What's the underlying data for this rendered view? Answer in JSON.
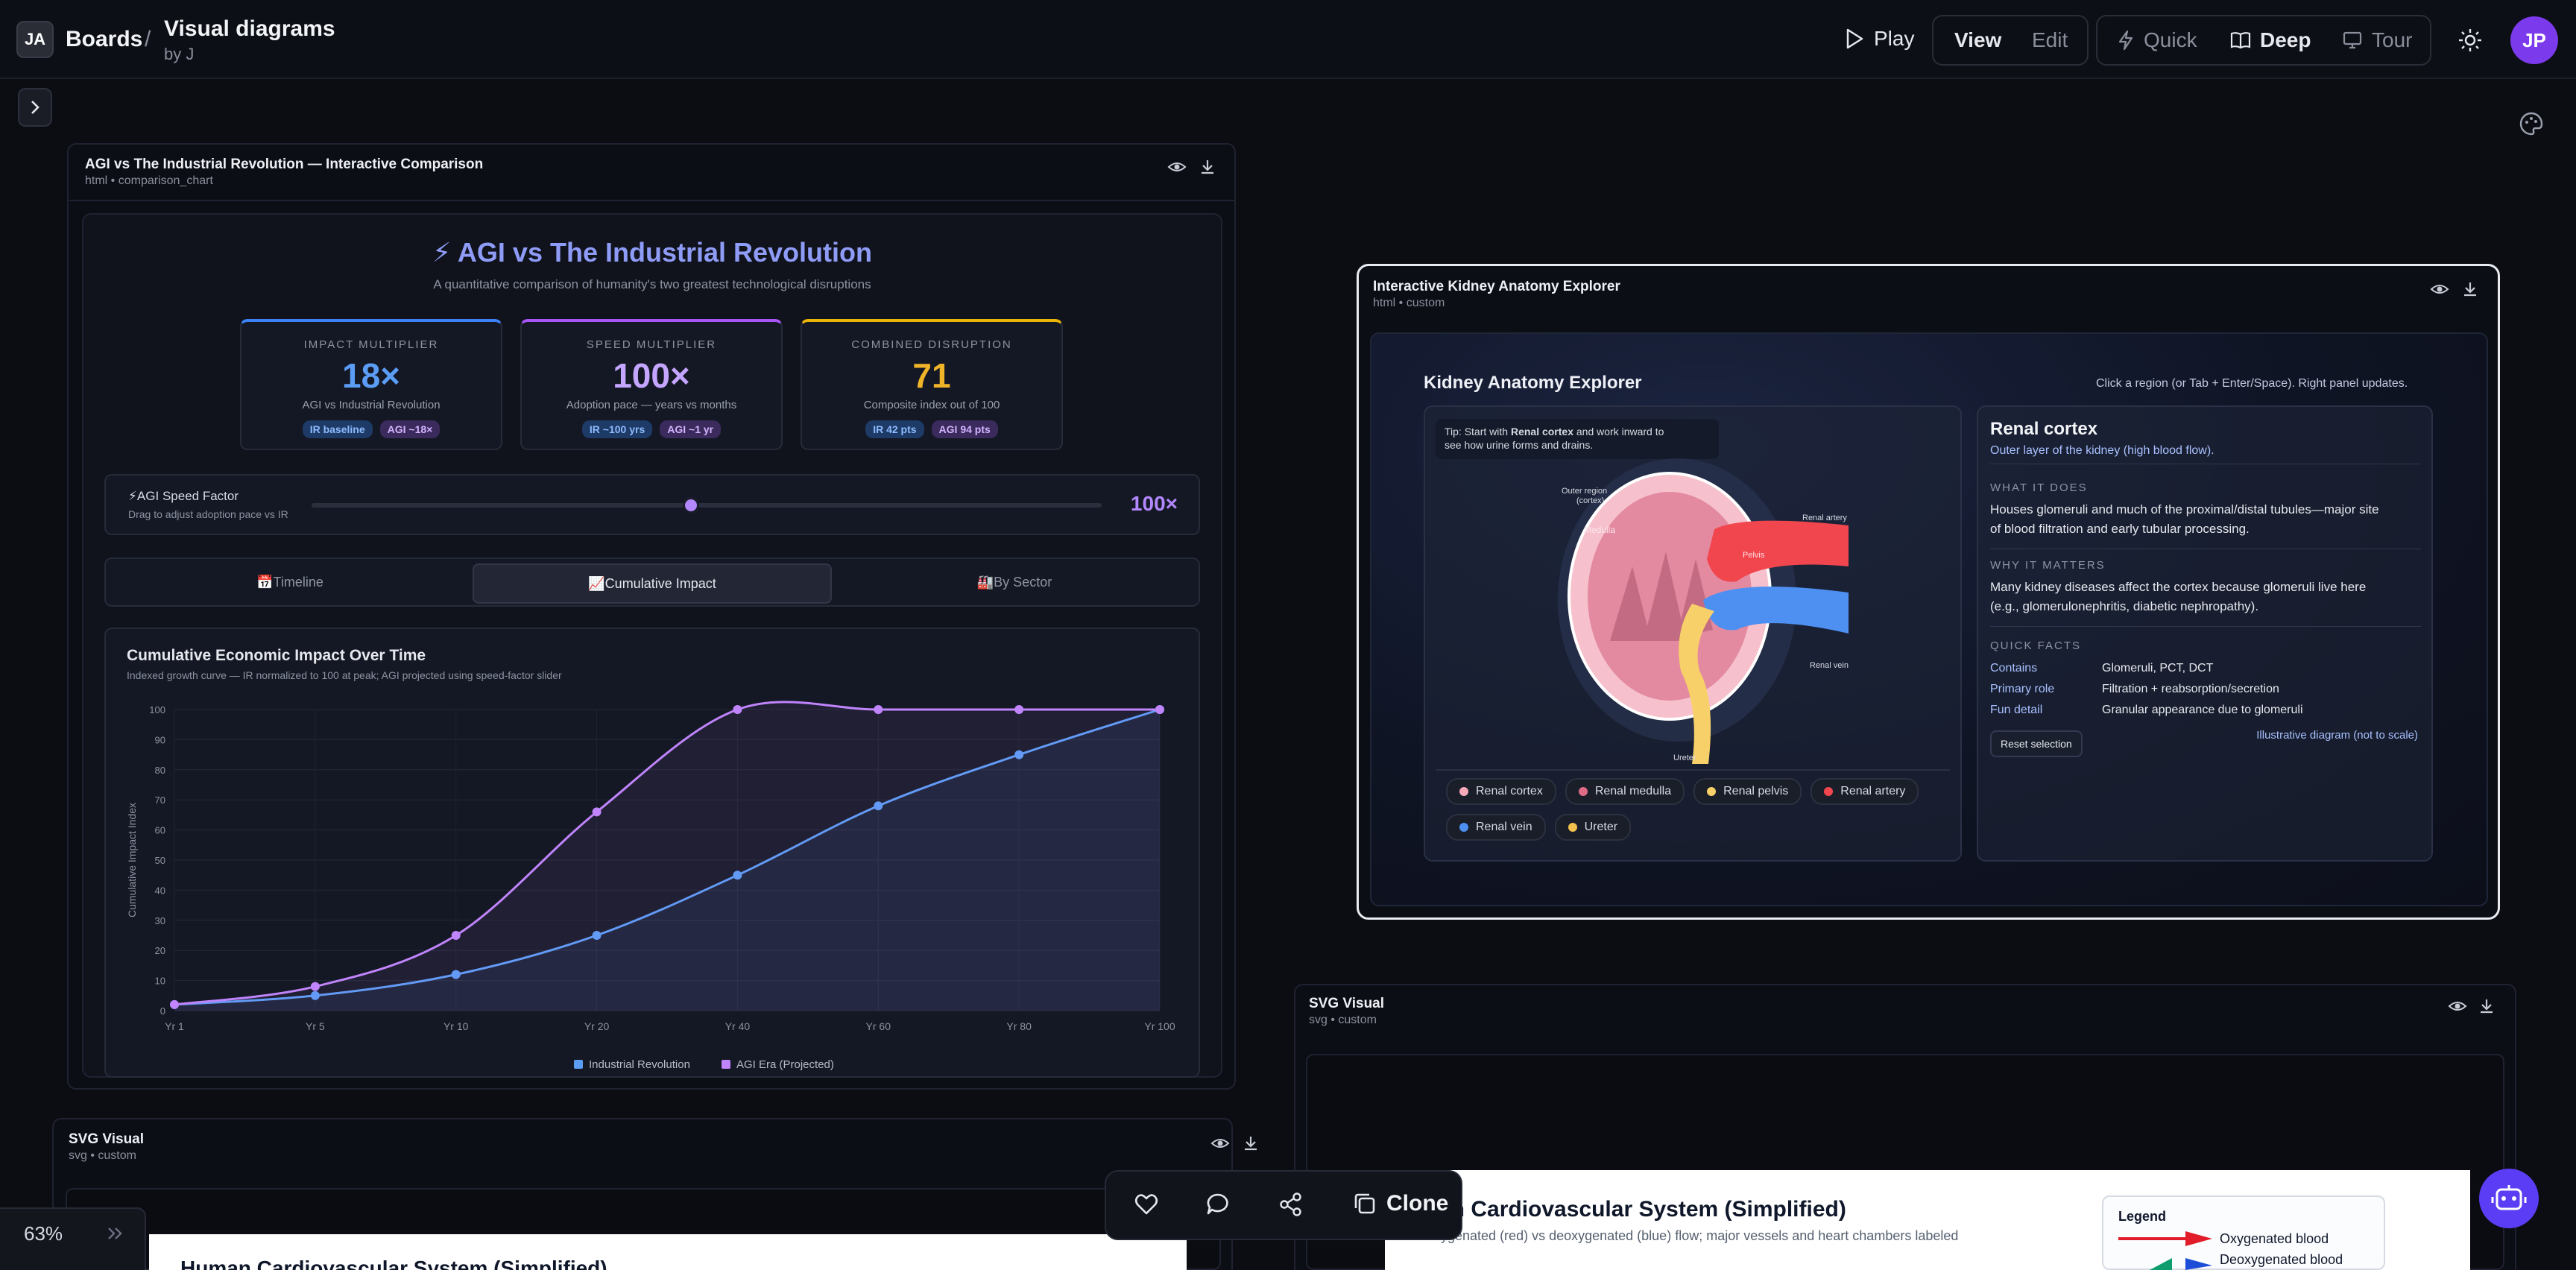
{
  "header": {
    "logo_text": "JA",
    "breadcrumb_root": "Boards",
    "separator": "/",
    "board_title": "Visual diagrams",
    "board_author": "by J",
    "play": "Play",
    "view": "View",
    "edit": "Edit",
    "quick": "Quick",
    "deep": "Deep",
    "tour": "Tour",
    "avatar": "JP"
  },
  "zoom": "63%",
  "bottom": {
    "clone": "Clone"
  },
  "card1": {
    "title": "AGI vs The Industrial Revolution — Interactive Comparison",
    "sub": "html • comparison_chart",
    "heading": "⚡ AGI vs The Industrial Revolution",
    "subheading": "A quantitative comparison of humanity's two greatest technological disruptions",
    "stats": [
      {
        "k": "IMPACT MULTIPLIER",
        "v": "18×",
        "d": "AGI vs Industrial Revolution",
        "p1": "IR baseline",
        "p2": "AGI ~18×"
      },
      {
        "k": "SPEED MULTIPLIER",
        "v": "100×",
        "d": "Adoption pace — years vs months",
        "p1": "IR ~100 yrs",
        "p2": "AGI ~1 yr"
      },
      {
        "k": "COMBINED DISRUPTION",
        "v": "71",
        "d": "Composite index out of 100",
        "p1": "IR 42 pts",
        "p2": "AGI 94 pts"
      }
    ],
    "slider": {
      "label": "⚡AGI Speed Factor",
      "hint": "Drag to adjust adoption pace vs IR",
      "value": "100×",
      "level": 0.48
    },
    "tabs": [
      "📅Timeline",
      "📈Cumulative Impact",
      "🏭By Sector"
    ],
    "chart_title": "Cumulative Economic Impact Over Time",
    "chart_sub": "Indexed growth curve — IR normalized to 100 at peak; AGI projected using speed-factor slider"
  },
  "card2": {
    "title": "Interactive Kidney Anatomy Explorer",
    "sub": "html • custom",
    "heading": "Kidney Anatomy Explorer",
    "hint": "Click a region (or Tab + Enter/Space). Right panel updates.",
    "tip_pre": "Tip: Start with ",
    "tip_bold": "Renal cortex",
    "tip_post": " and work inward to",
    "tip_line2": "see how urine forms and drains.",
    "labels": {
      "outer": "Outer region",
      "cortex": "(cortex)",
      "medulla": "Medulla",
      "pelvis": "Pelvis",
      "artery": "Renal artery",
      "vein": "Renal vein",
      "ureter": "Ureter"
    },
    "chips": [
      "Renal cortex",
      "Renal medulla",
      "Renal pelvis",
      "Renal artery",
      "Renal vein",
      "Ureter"
    ],
    "panel": {
      "title": "Renal cortex",
      "subtitle": "Outer layer of the kidney (high blood flow).",
      "what_h": "WHAT IT DOES",
      "what_1": "Houses glomeruli and much of the proximal/distal tubules—major site",
      "what_2": "of blood filtration and early tubular processing.",
      "why_h": "WHY IT MATTERS",
      "why_1": "Many kidney diseases affect the cortex because glomeruli live here",
      "why_2": "(e.g., glomerulonephritis, diabetic nephropathy).",
      "facts_h": "QUICK FACTS",
      "f1k": "Contains",
      "f1v": "Glomeruli, PCT, DCT",
      "f2k": "Primary role",
      "f2v": "Filtration + reabsorption/secretion",
      "f3k": "Fun detail",
      "f3v": "Granular appearance due to glomeruli",
      "reset": "Reset selection",
      "note": "Illustrative diagram (not to scale)"
    }
  },
  "card3": {
    "title": "SVG Visual",
    "sub": "svg • custom",
    "heading": "Human Cardiovascular System (Simplified)",
    "heading_visible": "an Cardiovascular System (Simplified)",
    "desc": "Oxygenated (red) vs deoxygenated (blue) flow; major vessels and heart chambers labeled",
    "legend": "Legend",
    "leg1": "Oxygenated blood",
    "leg2": "Deoxygenated blood"
  },
  "card4": {
    "title": "SVG Visual",
    "sub": "svg • custom",
    "heading_partial": "Human Cardiovascular System (Simplified)"
  },
  "chart_data": {
    "type": "line",
    "title": "Cumulative Economic Impact Over Time",
    "ylabel": "Cumulative Impact Index",
    "categories": [
      "Yr 1",
      "Yr 5",
      "Yr 10",
      "Yr 20",
      "Yr 40",
      "Yr 60",
      "Yr 80",
      "Yr 100"
    ],
    "ylim": [
      0,
      100
    ],
    "yticks": [
      0,
      10,
      20,
      30,
      40,
      50,
      60,
      70,
      80,
      90,
      100
    ],
    "series": [
      {
        "name": "Industrial Revolution",
        "color": "#5b9cf5",
        "values": [
          2,
          5,
          12,
          25,
          45,
          68,
          85,
          100
        ]
      },
      {
        "name": "AGI Era (Projected)",
        "color": "#c084fc",
        "values": [
          2,
          8,
          25,
          66,
          100,
          100,
          100,
          100
        ]
      }
    ],
    "legend": "bottom",
    "grid": true
  }
}
